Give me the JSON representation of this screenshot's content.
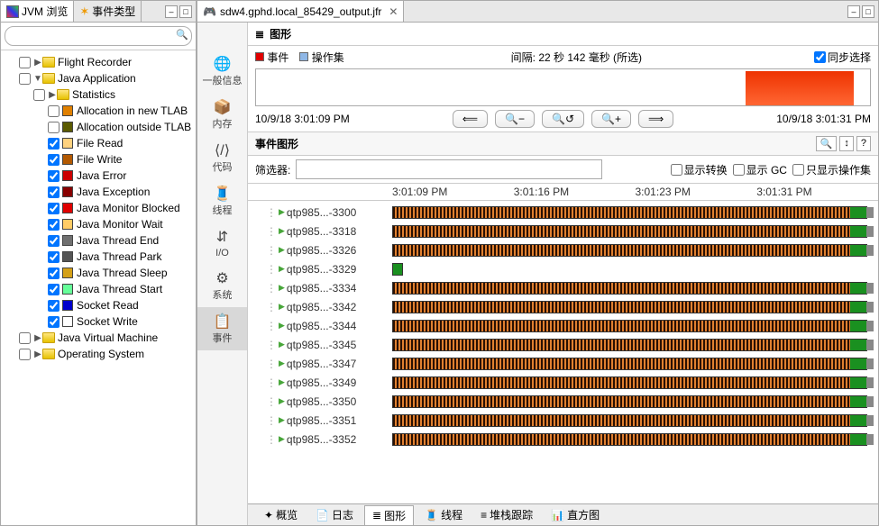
{
  "left_panel": {
    "tabs": [
      {
        "label": "JVM 浏览",
        "active": true
      },
      {
        "label": "事件类型",
        "active": false
      }
    ],
    "search_placeholder": "",
    "tree": [
      {
        "type": "folder",
        "label": "Flight Recorder",
        "indent": 1,
        "checked": false,
        "arrow": "▶"
      },
      {
        "type": "folder",
        "label": "Java Application",
        "indent": 1,
        "checked": false,
        "arrow": "▼"
      },
      {
        "type": "folder",
        "label": "Statistics",
        "indent": 2,
        "checked": false,
        "arrow": "▶"
      },
      {
        "type": "swatch",
        "label": "Allocation in new TLAB",
        "indent": 3,
        "checked": false,
        "color": "#e08000"
      },
      {
        "type": "swatch",
        "label": "Allocation outside TLAB",
        "indent": 3,
        "checked": false,
        "color": "#5a5a00"
      },
      {
        "type": "swatch",
        "label": "File Read",
        "indent": 3,
        "checked": true,
        "color": "#ffd27f"
      },
      {
        "type": "swatch",
        "label": "File Write",
        "indent": 3,
        "checked": true,
        "color": "#b35900"
      },
      {
        "type": "swatch",
        "label": "Java Error",
        "indent": 3,
        "checked": true,
        "color": "#cc0000"
      },
      {
        "type": "swatch",
        "label": "Java Exception",
        "indent": 3,
        "checked": true,
        "color": "#880000"
      },
      {
        "type": "swatch",
        "label": "Java Monitor Blocked",
        "indent": 3,
        "checked": true,
        "color": "#e00000"
      },
      {
        "type": "swatch",
        "label": "Java Monitor Wait",
        "indent": 3,
        "checked": true,
        "color": "#ffcc66"
      },
      {
        "type": "swatch",
        "label": "Java Thread End",
        "indent": 3,
        "checked": true,
        "color": "#707070"
      },
      {
        "type": "swatch",
        "label": "Java Thread Park",
        "indent": 3,
        "checked": true,
        "color": "#555555"
      },
      {
        "type": "swatch",
        "label": "Java Thread Sleep",
        "indent": 3,
        "checked": true,
        "color": "#d4a017"
      },
      {
        "type": "swatch",
        "label": "Java Thread Start",
        "indent": 3,
        "checked": true,
        "color": "#66ff99"
      },
      {
        "type": "swatch",
        "label": "Socket Read",
        "indent": 3,
        "checked": true,
        "color": "#0000cc"
      },
      {
        "type": "swatch",
        "label": "Socket Write",
        "indent": 3,
        "checked": true,
        "color": "#ffffff"
      },
      {
        "type": "folder",
        "label": "Java Virtual Machine",
        "indent": 1,
        "checked": false,
        "arrow": "▶"
      },
      {
        "type": "folder",
        "label": "Operating System",
        "indent": 1,
        "checked": false,
        "arrow": "▶"
      }
    ]
  },
  "file_tab": {
    "label": "sdw4.gphd.local_85429_output.jfr"
  },
  "side_nav": [
    {
      "icon": "🌐",
      "label": "一般信息",
      "selected": false
    },
    {
      "icon": "📦",
      "label": "内存",
      "selected": false
    },
    {
      "icon": "⟨/⟩",
      "label": "代码",
      "selected": false
    },
    {
      "icon": "🧵",
      "label": "线程",
      "selected": false
    },
    {
      "icon": "⇵",
      "label": "I/O",
      "selected": false
    },
    {
      "icon": "⚙",
      "label": "系统",
      "selected": false
    },
    {
      "icon": "📋",
      "label": "事件",
      "selected": true
    }
  ],
  "main": {
    "title": "图形",
    "overview": {
      "legend": [
        {
          "label": "事件",
          "color": "#e00000"
        },
        {
          "label": "操作集",
          "color": "#8fb7e6"
        }
      ],
      "interval_label": "间隔: 22 秒 142 毫秒 (所选)",
      "sync_label": "同步选择",
      "start_time": "10/9/18 3:01:09 PM",
      "end_time": "10/9/18 3:01:31 PM",
      "nav_buttons": [
        "⟸",
        "🔍−",
        "🔍↺",
        "🔍+",
        "⟹"
      ]
    },
    "graph": {
      "title": "事件图形",
      "filter_label": "筛选器:",
      "checks": [
        {
          "label": "显示转换"
        },
        {
          "label": "显示 GC"
        },
        {
          "label": "只显示操作集"
        }
      ],
      "time_ticks": [
        "3:01:09 PM",
        "3:01:16 PM",
        "3:01:23 PM",
        "3:01:31 PM"
      ],
      "threads": [
        {
          "label": "qtp985...-3300",
          "short": false
        },
        {
          "label": "qtp985...-3318",
          "short": false
        },
        {
          "label": "qtp985...-3326",
          "short": false
        },
        {
          "label": "qtp985...-3329",
          "short": true
        },
        {
          "label": "qtp985...-3334",
          "short": false
        },
        {
          "label": "qtp985...-3342",
          "short": false
        },
        {
          "label": "qtp985...-3344",
          "short": false
        },
        {
          "label": "qtp985...-3345",
          "short": false
        },
        {
          "label": "qtp985...-3347",
          "short": false
        },
        {
          "label": "qtp985...-3349",
          "short": false
        },
        {
          "label": "qtp985...-3350",
          "short": false
        },
        {
          "label": "qtp985...-3351",
          "short": false
        },
        {
          "label": "qtp985...-3352",
          "short": false
        }
      ]
    }
  },
  "bottom_tabs": [
    {
      "icon": "✦",
      "label": "概览",
      "selected": false
    },
    {
      "icon": "📄",
      "label": "日志",
      "selected": false
    },
    {
      "icon": "≣",
      "label": "图形",
      "selected": true
    },
    {
      "icon": "🧵",
      "label": "线程",
      "selected": false
    },
    {
      "icon": "≡",
      "label": "堆栈跟踪",
      "selected": false
    },
    {
      "icon": "📊",
      "label": "直方图",
      "selected": false
    }
  ]
}
